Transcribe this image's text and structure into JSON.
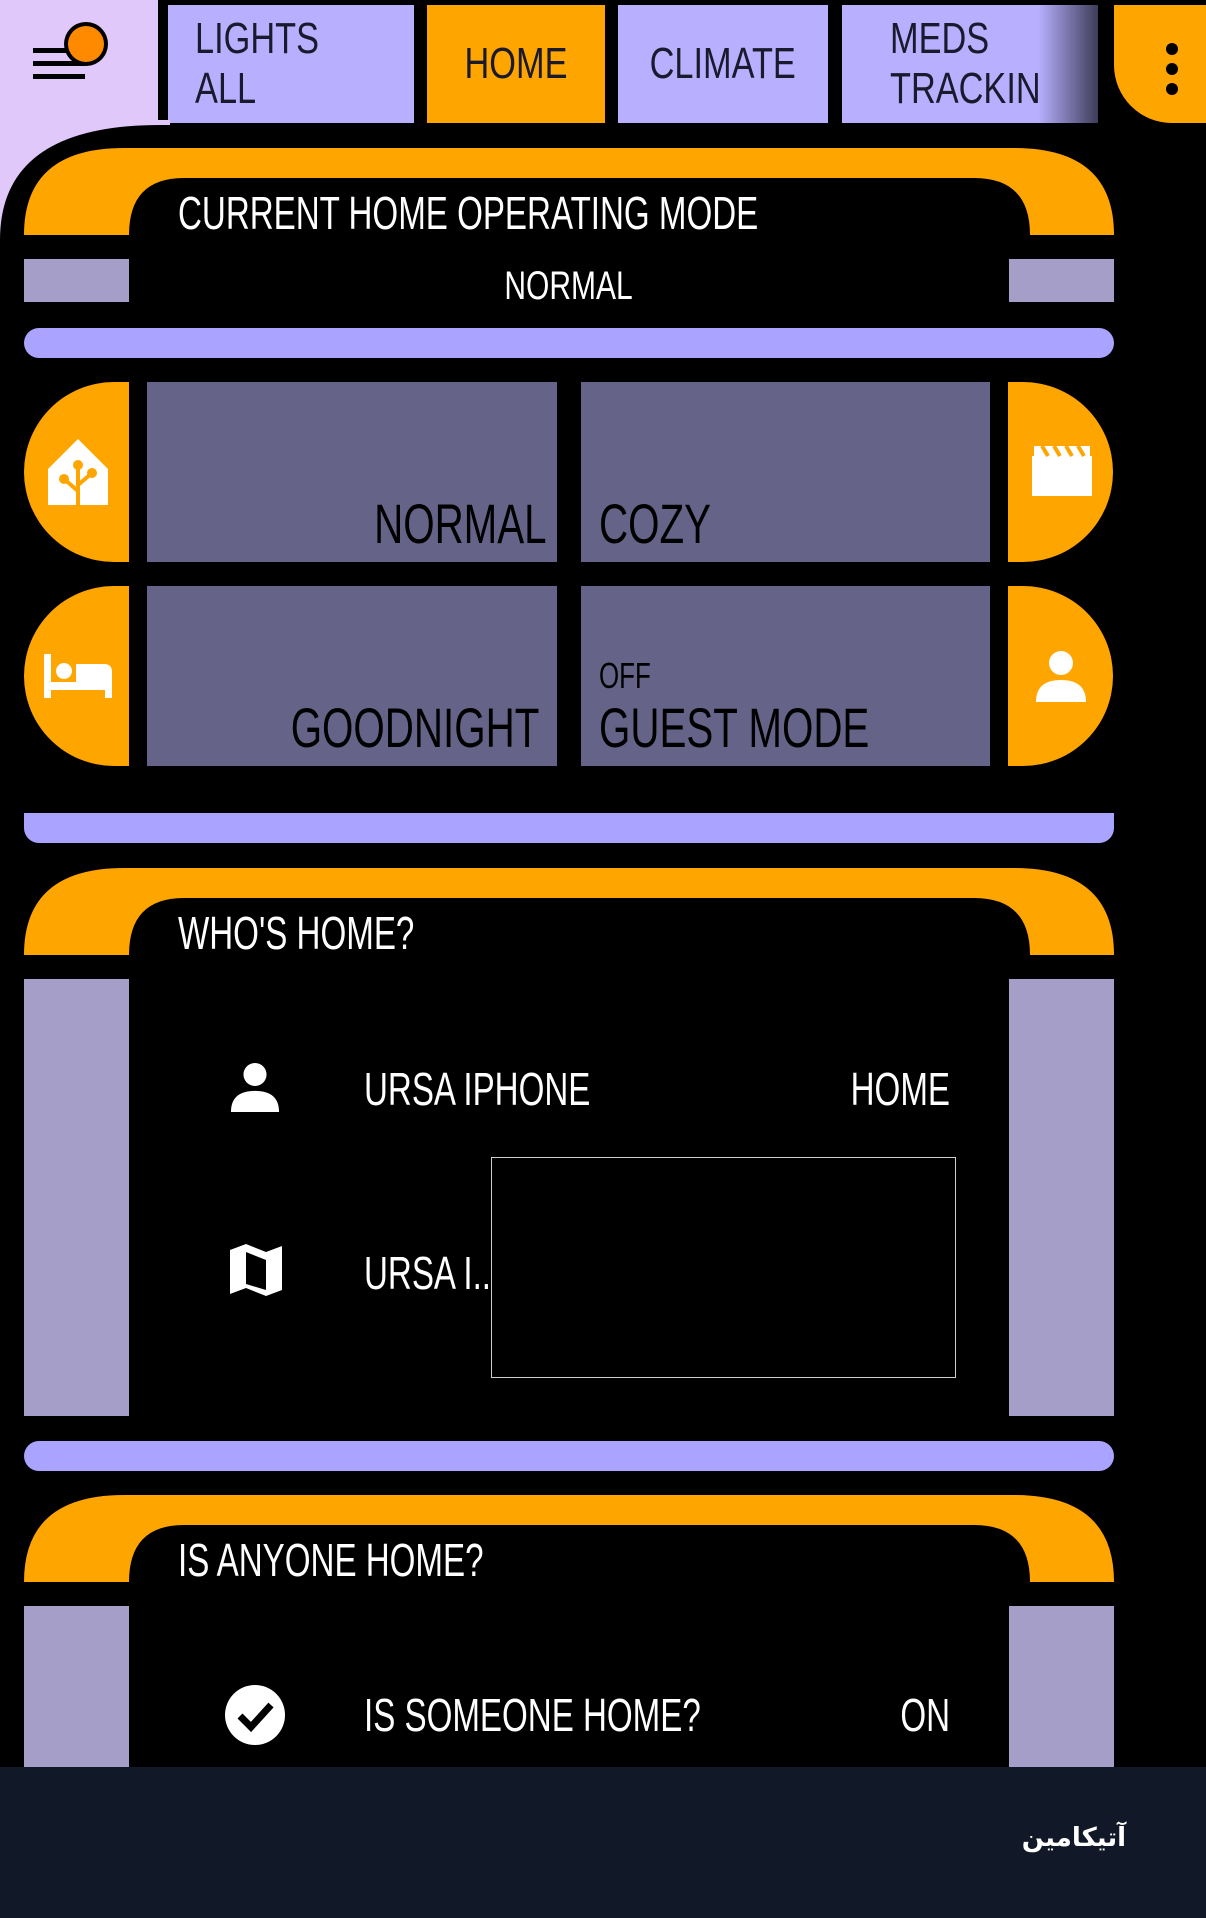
{
  "header": {
    "tabs": [
      {
        "label": "LIGHTS ALL",
        "active": false
      },
      {
        "label": "HOME",
        "active": true
      },
      {
        "label": "CLIMATE",
        "active": false
      },
      {
        "label": "MEDS TRACKIN",
        "active": false
      }
    ],
    "menu_icon": "hamburger-dot-icon",
    "overflow_icon": "more-vert-icon"
  },
  "mode_card": {
    "title": "CURRENT HOME OPERATING MODE",
    "value": "NORMAL"
  },
  "mode_buttons": {
    "normal": {
      "label": "NORMAL",
      "icon": "home-assistant-icon"
    },
    "cozy": {
      "label": "COZY",
      "icon": "movie-clapper-icon"
    },
    "goodnight": {
      "label": "GOODNIGHT",
      "icon": "bed-icon"
    },
    "guest": {
      "label": "GUEST MODE",
      "state": "OFF",
      "icon": "account-icon"
    }
  },
  "whos_home": {
    "title": "WHO'S HOME?",
    "rows": [
      {
        "icon": "account-icon",
        "name": "URSA IPHONE",
        "state": "HOME"
      },
      {
        "icon": "map-icon",
        "name": "URSA I..."
      }
    ]
  },
  "anyone_home": {
    "title": "IS ANYONE HOME?",
    "rows": [
      {
        "icon": "check-circle-icon",
        "name": "IS SOMEONE HOME?",
        "state": "ON"
      }
    ]
  },
  "footer": {
    "watermark": "آتیکامین"
  },
  "colors": {
    "orange": "#ffa500",
    "lilac": "#a49ec9",
    "slate": "#656488",
    "violet": "#aaa3ff",
    "tab": "#b8b0ff",
    "footer": "#111827"
  }
}
